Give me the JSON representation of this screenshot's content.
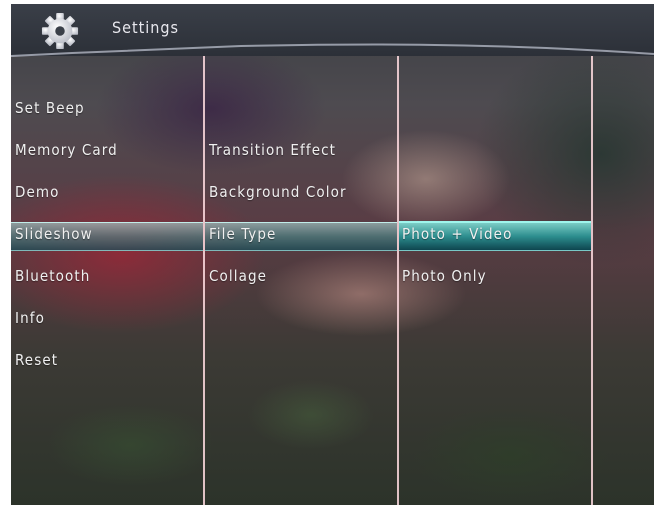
{
  "header": {
    "title": "Settings",
    "icon": "gear-icon"
  },
  "menu": {
    "column1": [
      "Set Beep",
      "Memory Card",
      "Demo",
      "Slideshow",
      "Bluetooth",
      "Info",
      "Reset"
    ],
    "column2": [
      "Transition Effect",
      "Background Color",
      "File Type",
      "Collage"
    ],
    "column3": [
      "Photo + Video",
      "Photo Only"
    ]
  },
  "selection": {
    "column1": "Slideshow",
    "column2": "File Type",
    "column3": "Photo + Video"
  },
  "colors": {
    "highlight": "#3fa3a0",
    "divider": "#ffdce1",
    "text": "#f0f0f0"
  }
}
